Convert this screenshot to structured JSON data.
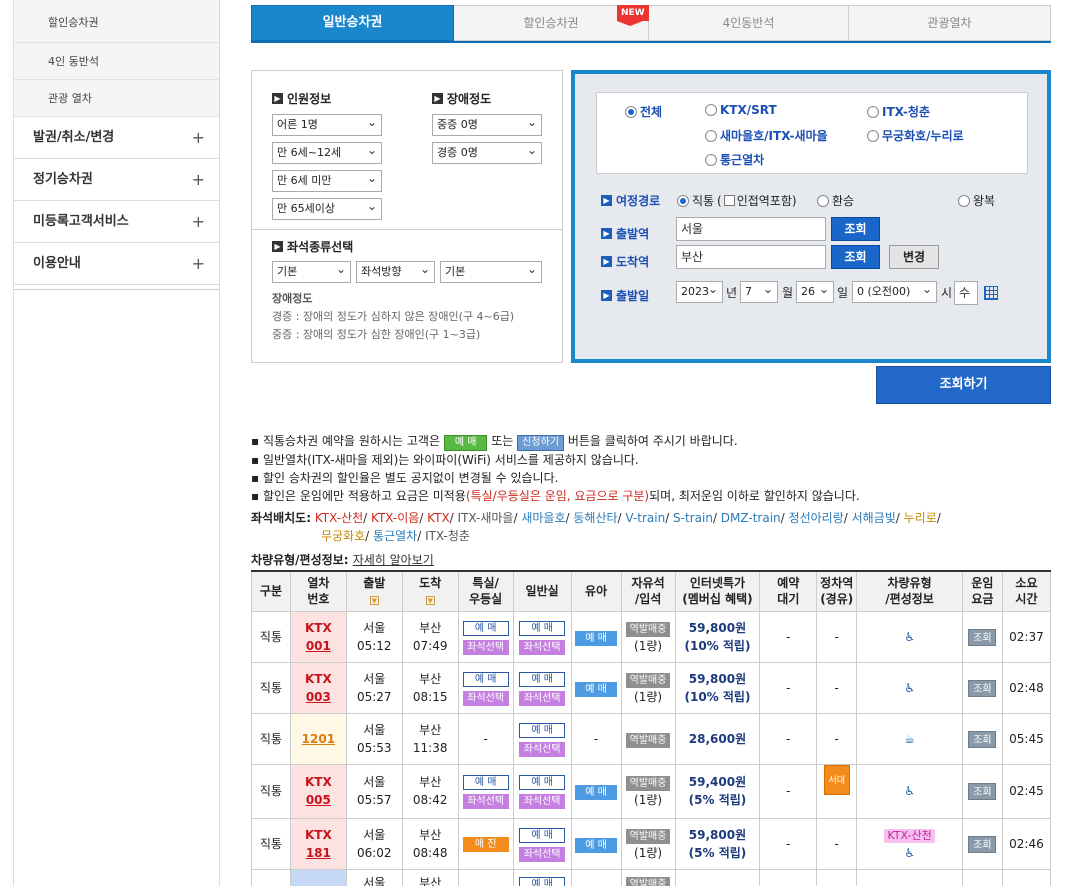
{
  "sidebar": {
    "sub_items": [
      "할인승차권",
      "4인 동반석",
      "관광 열차"
    ],
    "main_items": [
      {
        "label": "발권/취소/변경",
        "icon": "+"
      },
      {
        "label": "정기승차권",
        "icon": "+"
      },
      {
        "label": "미등록고객서비스",
        "icon": "+"
      },
      {
        "label": "이용안내",
        "icon": "+"
      }
    ]
  },
  "tabs": [
    "일반승차권",
    "할인승차권",
    "4인동반석",
    "관광열차"
  ],
  "new_badge": "NEW",
  "passenger": {
    "title": "인원정보",
    "adult": "어른 1명",
    "child": "만 6세~12세",
    "infant": "만 6세 미만",
    "senior": "만 65세이상"
  },
  "disability": {
    "title": "장애정도",
    "severe": "중증 0명",
    "mild": "경증 0명"
  },
  "seat_type": {
    "title": "좌석종류선택",
    "opt1": "기본",
    "opt2": "좌석방향",
    "opt3": "기본"
  },
  "disability_note": {
    "title": "장애정도",
    "line1": "경증 : 장애의 정도가 심하지 않은 장애인(구 4~6급)",
    "line2": "중증 : 장애의 정도가 심한 장애인(구 1~3급)"
  },
  "train_types": {
    "all": "전체",
    "ktx": "KTX/SRT",
    "itx_cheongchun": "ITX-청춘",
    "saemaeul": "새마을호/ITX-새마을",
    "mugunghwa": "무궁화호/누리로",
    "commuter": "통근열차"
  },
  "route": {
    "label": "여정경로",
    "direct": "직통",
    "nearby_prefix": "(",
    "nearby": "인접역포함)",
    "transfer": "환승",
    "round": "왕복"
  },
  "depart": {
    "label": "출발역",
    "value": "서울",
    "btn": "조회"
  },
  "arrive": {
    "label": "도착역",
    "value": "부산",
    "btn": "조회",
    "swap": "변경"
  },
  "date": {
    "label": "출발일",
    "year": "2023",
    "year_unit": "년",
    "month": "7",
    "month_unit": "월",
    "day": "26",
    "day_unit": "일",
    "hour": "0 (오전00)",
    "hour_unit": "시",
    "weekday": "수"
  },
  "search_button": "조회하기",
  "info": {
    "l1a": "▪ 직통승차권 예약을 원하시는 고객은",
    "l1_badge1": "예 매",
    "l1b": "또는",
    "l1_badge2": "신청하기",
    "l1c": "버튼을 클릭하여 주시기 바랍니다.",
    "l2": "▪ 일반열차(ITX-새마을 제외)는 와이파이(WiFi) 서비스를 제공하지 않습니다.",
    "l3": "▪ 할인 승차권의 할인율은 별도 공지없이 변경될 수 있습니다.",
    "l4a": "▪ 할인은 운임에만 적용하고 요금은 미적용",
    "l4b": "(특실/우등실은 운임, 요금으로 구분)",
    "l4c": "되며, 최저운임 이하로 할인하지 않습니다."
  },
  "seatmap": {
    "label": "좌석배치도:",
    "links1": [
      {
        "t": "KTX-산천",
        "c": "#cc2a1b"
      },
      {
        "t": "KTX-이음",
        "c": "#cc2a1b"
      },
      {
        "t": "KTX",
        "c": "#cc2a1b"
      },
      {
        "t": "ITX-새마을",
        "c": "#555555"
      },
      {
        "t": "새마을호",
        "c": "#2a7ab8"
      },
      {
        "t": "동해산타",
        "c": "#2a7ab8"
      },
      {
        "t": "V-train",
        "c": "#2a7ab8"
      },
      {
        "t": "S-train",
        "c": "#2a7ab8"
      },
      {
        "t": "DMZ-train",
        "c": "#2a7ab8"
      },
      {
        "t": "정선아리랑",
        "c": "#2a7ab8"
      },
      {
        "t": "서해금빛",
        "c": "#2a7ab8"
      },
      {
        "t": "누리로",
        "c": "#c28a00"
      }
    ],
    "links2": [
      {
        "t": "무궁화호",
        "c": "#c28a00"
      },
      {
        "t": "통근열차",
        "c": "#2a7ab8"
      },
      {
        "t": "ITX-청춘",
        "c": "#555555"
      }
    ]
  },
  "composition": {
    "title": "차량유형/편성정보:",
    "link": "자세히 알아보기"
  },
  "table": {
    "headers": [
      "구분",
      "열차\n번호",
      "출발",
      "도착",
      "특실/\n우등실",
      "일반실",
      "유아",
      "자유석\n/입석",
      "인터넷특가\n(멤버십 혜택)",
      "예약\n대기",
      "정차역\n(경유)",
      "차량유형\n/편성정보",
      "운임\n요금",
      "소요\n시간"
    ],
    "rows": [
      {
        "kind": "직통",
        "train_type": "KTX",
        "train_no": "001",
        "dep": "서울",
        "dep_time": "05:12",
        "arr": "부산",
        "arr_time": "07:49",
        "special": [
          "예 매",
          "좌석선택"
        ],
        "general": [
          "예 매",
          "좌석선택"
        ],
        "infant": "예 매",
        "free": [
          "역발매중",
          "(1량)"
        ],
        "price": "59,800원",
        "benefit": "(10% 적립)",
        "wait": "-",
        "stop": "-",
        "vehicle": "wheelchair",
        "fare": "조회",
        "duration": "02:37"
      },
      {
        "kind": "직통",
        "train_type": "KTX",
        "train_no": "003",
        "dep": "서울",
        "dep_time": "05:27",
        "arr": "부산",
        "arr_time": "08:15",
        "special": [
          "예 매",
          "좌석선택"
        ],
        "general": [
          "예 매",
          "좌석선택"
        ],
        "infant": "예 매",
        "free": [
          "역발매중",
          "(1량)"
        ],
        "price": "59,800원",
        "benefit": "(10% 적립)",
        "wait": "-",
        "stop": "-",
        "vehicle": "wheelchair",
        "fare": "조회",
        "duration": "02:48"
      },
      {
        "kind": "직통",
        "train_type": "",
        "train_no": "1201",
        "dep": "서울",
        "dep_time": "05:53",
        "arr": "부산",
        "arr_time": "11:38",
        "special": [
          "-"
        ],
        "general": [
          "예 매",
          "좌석선택"
        ],
        "infant": "-",
        "free": [
          "역발매중"
        ],
        "price": "28,600원",
        "benefit": "",
        "wait": "-",
        "stop": "-",
        "vehicle": "cafe",
        "fare": "조회",
        "duration": "05:45"
      },
      {
        "kind": "직통",
        "train_type": "KTX",
        "train_no": "005",
        "dep": "서울",
        "dep_time": "05:57",
        "arr": "부산",
        "arr_time": "08:42",
        "special": [
          "예 매",
          "좌석선택"
        ],
        "general": [
          "예 매",
          "좌석선택"
        ],
        "infant": "예 매",
        "free": [
          "역발매중",
          "(1량)"
        ],
        "price": "59,400원",
        "benefit": "(5% 적립)",
        "wait": "-",
        "stop": "서대구",
        "vehicle": "wheelchair",
        "fare": "조회",
        "duration": "02:45"
      },
      {
        "kind": "직통",
        "train_type": "KTX",
        "train_no": "181",
        "dep": "서울",
        "dep_time": "06:02",
        "arr": "부산",
        "arr_time": "08:48",
        "special": [
          "매 진"
        ],
        "general": [
          "예 매",
          "좌석선택"
        ],
        "infant": "예 매",
        "free": [
          "역발매중",
          "(1량)"
        ],
        "price": "59,800원",
        "benefit": "(5% 적립)",
        "wait": "-",
        "stop": "-",
        "vehicle": "KTX-산천",
        "fare": "조회",
        "duration": "02:46"
      }
    ],
    "partial_row": {
      "dep": "서울",
      "arr": "부산",
      "general": "예 매",
      "free": "역발매중"
    }
  }
}
